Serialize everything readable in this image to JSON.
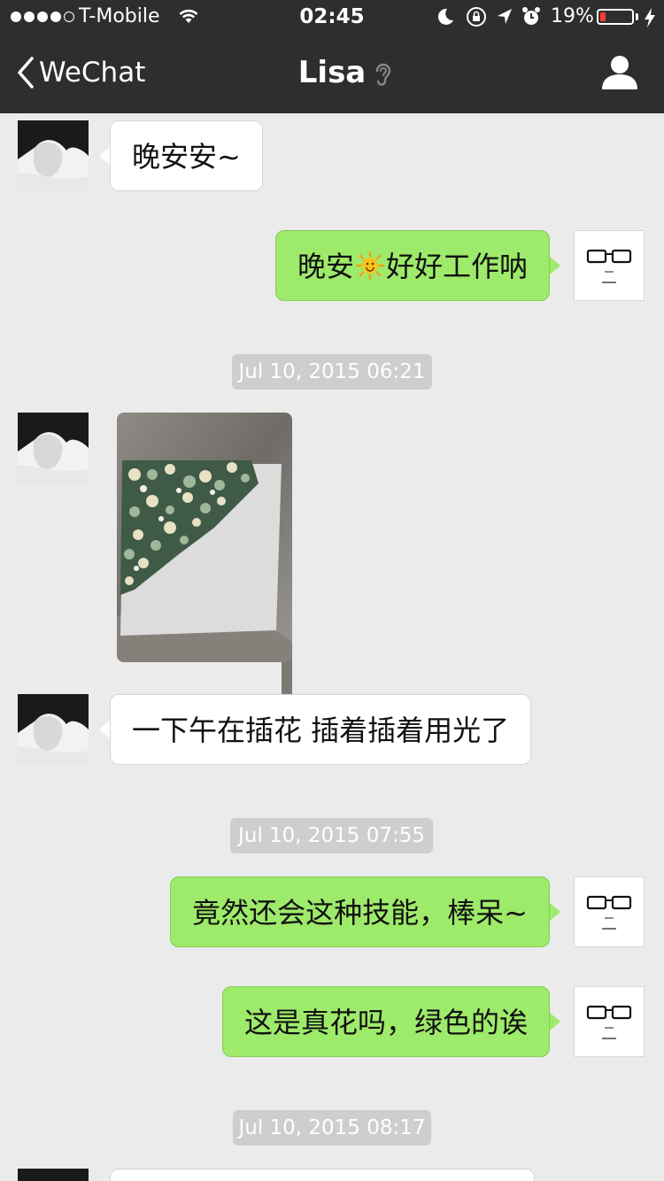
{
  "status_bar": {
    "carrier": "T-Mobile",
    "time": "02:45",
    "battery": "19%",
    "battery_level": 0.19,
    "battery_color": "#ff3b30"
  },
  "nav": {
    "back_label": "WeChat",
    "title": "Lisa",
    "icons": [
      "chevron-left-icon",
      "ear-icon",
      "profile-icon"
    ]
  },
  "messages": [
    {
      "from": "contact",
      "text": "晚安安~"
    },
    {
      "from": "me",
      "text_before": "晚安",
      "emoji": "sun-emoji",
      "text_after": "好好工作呐"
    },
    {
      "timestamp": "Jul 10, 2015 06:21"
    },
    {
      "from": "contact",
      "type": "image",
      "description_icon": "flower-arrangement-photo"
    },
    {
      "from": "contact",
      "text": "一下午在插花 插着插着用光了"
    },
    {
      "timestamp": "Jul 10, 2015 07:55"
    },
    {
      "from": "me",
      "text": "竟然还会这种技能，棒呆~"
    },
    {
      "from": "me",
      "text": "这是真花吗，绿色的诶"
    },
    {
      "timestamp": "Jul 10, 2015 08:17"
    }
  ],
  "colors": {
    "nav_bg": "#2e2e31",
    "chat_bg": "#ebebeb",
    "my_bubble": "#9eea6a",
    "their_bubble": "#ffffff",
    "timestamp_bg": "#cecece"
  }
}
